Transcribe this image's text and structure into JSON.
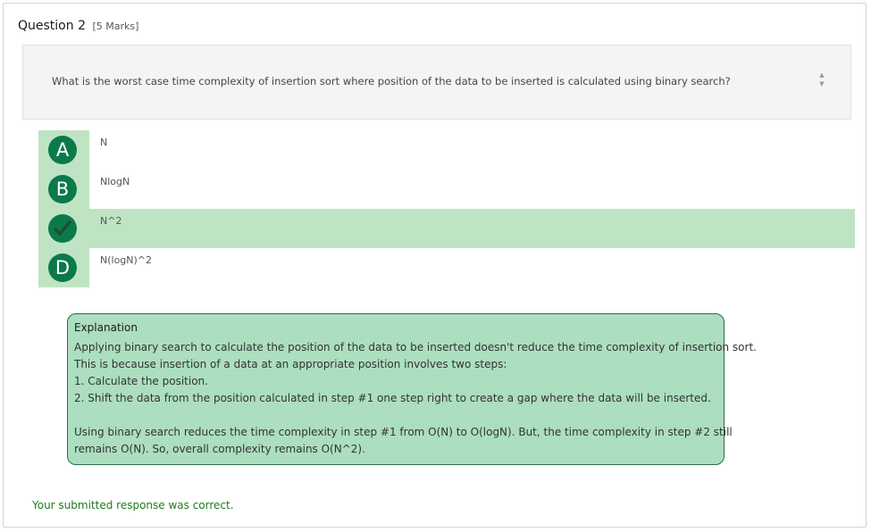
{
  "question": {
    "title": "Question 2",
    "marks": "[5 Marks]",
    "text": "What is the worst case time complexity of insertion sort where position of the data to be inserted is calculated using binary search?"
  },
  "options": [
    {
      "letter": "A",
      "text": "N",
      "state": "unselected"
    },
    {
      "letter": "B",
      "text": "NlogN",
      "state": "unselected"
    },
    {
      "letter": "C",
      "text": "N^2",
      "state": "selected-correct",
      "icon": "checkmark-icon"
    },
    {
      "letter": "D",
      "text": "N(logN)^2",
      "state": "unselected"
    }
  ],
  "explanation": {
    "title": "Explanation",
    "lines": [
      "Applying binary search to calculate the position of the data to be inserted doesn't reduce the time complexity of insertion sort.",
      "This is because insertion of a data at an appropriate position involves two steps:",
      "1. Calculate the position.",
      "2. Shift the data from the position calculated in step #1 one step right to create a gap where the data will be inserted.",
      "",
      "Using binary search reduces the time complexity in step #1 from O(N) to O(logN). But, the time complexity in step #2 still",
      "remains O(N). So, overall complexity remains O(N^2)."
    ]
  },
  "feedback": "Your submitted response was correct.",
  "colors": {
    "accent": "#0b7a4b",
    "selected_bg": "#bfe4c3",
    "explanation_bg": "#acdec0",
    "feedback_text": "#1f7a1f"
  }
}
